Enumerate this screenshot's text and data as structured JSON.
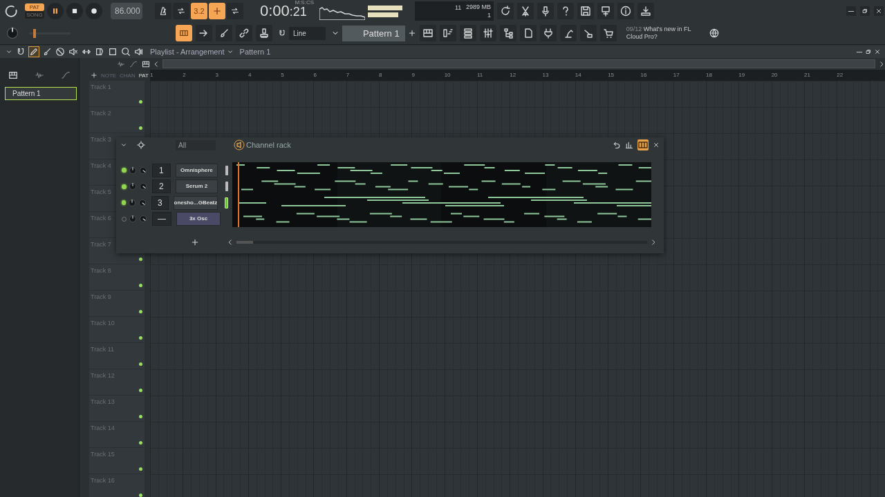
{
  "transport": {
    "modes": [
      {
        "label": "PAT",
        "selected": true
      },
      {
        "label": "SONG",
        "selected": false
      }
    ],
    "playing": true,
    "tempo": "86.000",
    "time": "0:00",
    "time_fraction": ":21",
    "time_unit": "M:S:CS"
  },
  "toggles": [
    {
      "kind": "icon",
      "on": false
    },
    {
      "kind": "icon",
      "on": false
    },
    {
      "kind": "text",
      "label": "3.2",
      "on": true
    },
    {
      "kind": "icon",
      "on": true
    },
    {
      "kind": "icon",
      "on": false
    }
  ],
  "monitor": {
    "cpu": "11",
    "memory": "2989 MB",
    "polyphony": "1"
  },
  "toolbar": {
    "snap": "Line",
    "pattern": "Pattern 1"
  },
  "master_pitch": {
    "level": 0.1
  },
  "news": {
    "date": "09/12",
    "text": "What's new in FL Cloud Pro?"
  },
  "playlist": {
    "title": "Playlist - Arrangement",
    "pattern": "Pattern 1",
    "filters": [
      "NOTE",
      "CHAN",
      "PAT"
    ],
    "patterns": [
      {
        "name": "Pattern 1",
        "selected": true
      }
    ],
    "ruler": [
      "1",
      "2",
      "3",
      "4",
      "5",
      "6",
      "7",
      "8",
      "9",
      "10",
      "11",
      "12",
      "13",
      "14",
      "15",
      "16",
      "17",
      "18",
      "19",
      "20",
      "21",
      "22"
    ],
    "tracks": [
      "Track 1",
      "Track 2",
      "Track 3",
      "Track 4",
      "Track 5",
      "Track 6",
      "Track 7",
      "Track 8",
      "Track 9",
      "Track 10",
      "Track 11",
      "Track 12",
      "Track 13",
      "Track 14",
      "Track 15",
      "Track 16"
    ]
  },
  "channel_rack": {
    "title": "Channel rack",
    "filter": "All",
    "channels": [
      {
        "number": "1",
        "name": "Omnisphere",
        "enabled": true,
        "selected": false
      },
      {
        "number": "2",
        "name": "Serum 2",
        "enabled": true,
        "selected": false
      },
      {
        "number": "3",
        "name": "onesho...GBeatz",
        "enabled": true,
        "selected": true
      },
      {
        "number": "—",
        "name": "3x Osc",
        "enabled": false,
        "selected": false
      }
    ]
  }
}
